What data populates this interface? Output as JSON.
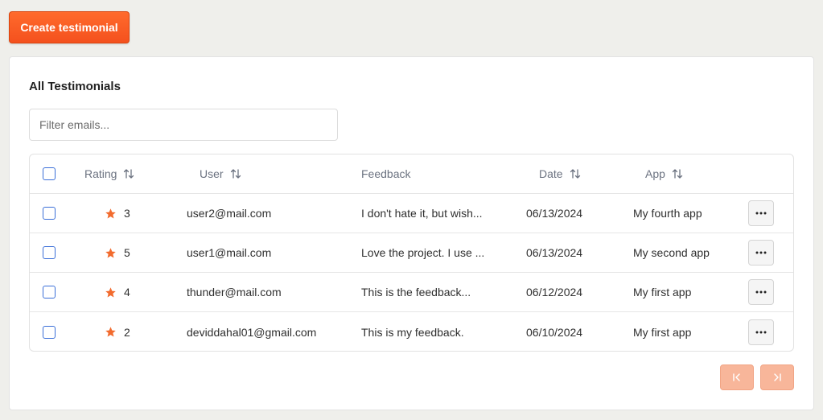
{
  "toolbar": {
    "create_label": "Create testimonial"
  },
  "card": {
    "title": "All Testimonials"
  },
  "filter": {
    "placeholder": "Filter emails..."
  },
  "table": {
    "headers": {
      "rating": "Rating",
      "user": "User",
      "feedback": "Feedback",
      "date": "Date",
      "app": "App"
    },
    "rows": [
      {
        "rating": "3",
        "user": "user2@mail.com",
        "feedback": "I don't hate it, but wish...",
        "date": "06/13/2024",
        "app": "My fourth app"
      },
      {
        "rating": "5",
        "user": "user1@mail.com",
        "feedback": "Love the project. I use ...",
        "date": "06/13/2024",
        "app": "My second app"
      },
      {
        "rating": "4",
        "user": "thunder@mail.com",
        "feedback": "This is the feedback...",
        "date": "06/12/2024",
        "app": "My first app"
      },
      {
        "rating": "2",
        "user": "deviddahal01@gmail.com",
        "feedback": "This is my feedback.",
        "date": "06/10/2024",
        "app": "My first app"
      }
    ]
  },
  "icons": {
    "sort": "sort-arrows-icon",
    "star": "star-icon",
    "more": "more-horizontal-icon",
    "first_page": "first-page-icon",
    "last_page": "last-page-icon"
  },
  "colors": {
    "accent": "#f4511e",
    "star": "#f26b2e",
    "pager_disabled": "#f8b69a",
    "checkbox": "#3b6fd8",
    "background": "#efefeb"
  }
}
